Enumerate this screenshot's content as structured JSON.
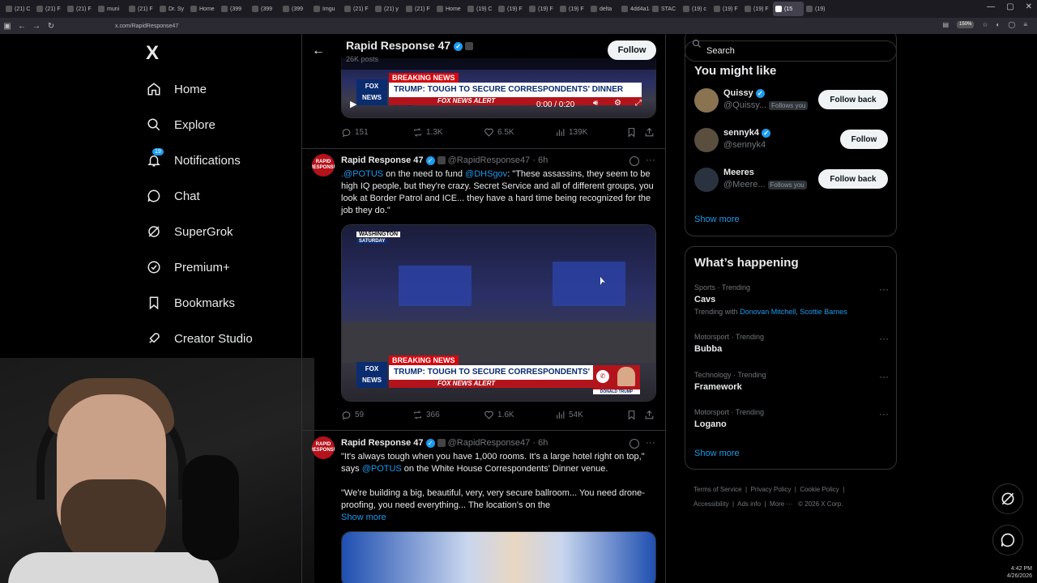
{
  "browser": {
    "tabs": [
      "(21) C",
      "(21) F",
      "(21) F",
      "muni",
      "(21) F",
      "Dr. Sy",
      "Home",
      "(399",
      "(399",
      "(399",
      "Imgu",
      "(21) F",
      "(21) y",
      "(21) F",
      "Home",
      "(19) C",
      "(19) F",
      "(19) F",
      "(19) F",
      "delta",
      "4dd4a14",
      "STAC",
      "(19) c",
      "(19) F",
      "(19) F",
      "(19)",
      "(19) F"
    ],
    "active_tab": "(15",
    "url": "x.com/RapidResponse47",
    "zoom": "150%"
  },
  "nav": {
    "logo": "X",
    "items": [
      {
        "label": "Home",
        "icon": "home-icon"
      },
      {
        "label": "Explore",
        "icon": "search-icon"
      },
      {
        "label": "Notifications",
        "icon": "bell-icon",
        "badge": "19"
      },
      {
        "label": "Chat",
        "icon": "chat-icon"
      },
      {
        "label": "SuperGrok",
        "icon": "grok-icon"
      },
      {
        "label": "Premium+",
        "icon": "premium-icon"
      },
      {
        "label": "Bookmarks",
        "icon": "bookmark-icon"
      },
      {
        "label": "Creator Studio",
        "icon": "rocket-icon"
      }
    ]
  },
  "profile_header": {
    "name": "Rapid Response 47",
    "posts": "26K posts",
    "follow_label": "Follow"
  },
  "tweets": [
    {
      "video": {
        "breaking": "BREAKING NEWS",
        "headline": "TRUMP: TOUGH TO SECURE CORRESPONDENTS' DINNER SITE",
        "alert": "FOX NEWS ALERT",
        "time": "0:00 / 0:20"
      },
      "stats": {
        "replies": "151",
        "reposts": "1.3K",
        "likes": "6.5K",
        "views": "139K"
      }
    },
    {
      "name": "Rapid Response 47",
      "handle": "@RapidResponse47",
      "age": "· 6h",
      "mention1": ".@POTUS",
      "text1": " on the need to fund ",
      "mention2": "@DHSgov",
      "text2": ": \"These assassins, they seem to be high IQ people, but they're crazy. Secret Service and all of different groups, you look at Border Patrol and ICE... they have a hard time being recognized for the job they do.\"",
      "video": {
        "location": "WASHINGTON",
        "day": "SATURDAY",
        "breaking": "BREAKING NEWS",
        "headline": "TRUMP: TOUGH TO SECURE CORRESPONDENTS' DINNER SITE",
        "alert": "FOX NEWS ALERT",
        "inset": "DONALD TRUMP"
      },
      "stats": {
        "replies": "59",
        "reposts": "366",
        "likes": "1.6K",
        "views": "54K"
      }
    },
    {
      "name": "Rapid Response 47",
      "handle": "@RapidResponse47",
      "age": "· 6h",
      "text1": "\"It's always tough when you have 1,000 rooms. It's a large hotel right on top,\" says ",
      "mention1": "@POTUS",
      "text2": " on the White House Correspondents' Dinner venue.",
      "text3": "\"We're building a big, beautiful, very, very secure ballroom... You need drone-proofing, you need everything... The location's on the",
      "show_more": "Show more"
    }
  ],
  "avatar_text": "RAPID RESPONSE",
  "sidebar": {
    "search_placeholder": "Search",
    "you_might_like": {
      "title": "You might like",
      "users": [
        {
          "name": "Quissy",
          "handle": "@Quissy...",
          "follows_you": "Follows you",
          "button": "Follow back",
          "avatar_color": "#8a7350"
        },
        {
          "name": "sennyk4",
          "handle": "@sennyk4",
          "follows_you": "",
          "button": "Follow",
          "avatar_color": "#5a4e3f"
        },
        {
          "name": "Meeres",
          "handle": "@Meere...",
          "follows_you": "Follows you",
          "button": "Follow back",
          "avatar_color": "#2a3240"
        }
      ],
      "show_more": "Show more"
    },
    "happening": {
      "title": "What’s happening",
      "trends": [
        {
          "meta": "Sports · Trending",
          "title": "Cavs",
          "with_label": "Trending with ",
          "with_links": "Donovan Mitchell, Scottie Barnes"
        },
        {
          "meta": "Motorsport · Trending",
          "title": "Bubba"
        },
        {
          "meta": "Technology · Trending",
          "title": "Framework"
        },
        {
          "meta": "Motorsport · Trending",
          "title": "Logano"
        }
      ],
      "show_more": "Show more"
    },
    "footer": [
      "Terms of Service",
      "Privacy Policy",
      "Cookie Policy",
      "Accessibility",
      "Ads info",
      "More ···",
      "© 2026 X Corp."
    ]
  },
  "taskbar": {
    "time": "4:42 PM",
    "date": "4/26/2026"
  },
  "colors": {
    "accent": "#1d9bf0",
    "background": "#000000",
    "border": "#2f3336",
    "muted": "#71767b"
  }
}
